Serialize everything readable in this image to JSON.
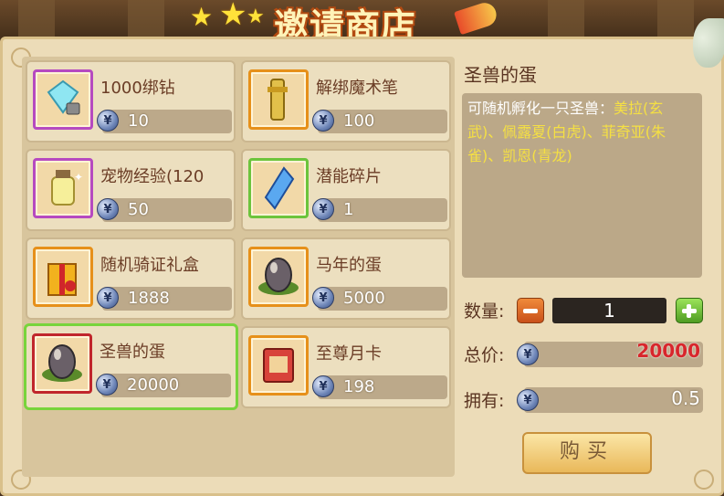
{
  "shop": {
    "title": "邀请商店"
  },
  "items": [
    {
      "name": "1000绑钻",
      "price": "10",
      "frame": "purple",
      "icon": "diamond-lock-icon"
    },
    {
      "name": "解绑魔术笔",
      "price": "100",
      "frame": "orange",
      "icon": "magic-pen-icon"
    },
    {
      "name": "宠物经验(120",
      "price": "50",
      "frame": "purple",
      "icon": "exp-bottle-icon"
    },
    {
      "name": "潜能碎片",
      "price": "1",
      "frame": "green",
      "icon": "blue-crystal-icon"
    },
    {
      "name": "随机骑证礼盒",
      "price": "1888",
      "frame": "orange",
      "icon": "gift-box-icon"
    },
    {
      "name": "马年的蛋",
      "price": "5000",
      "frame": "orange",
      "icon": "egg-icon"
    },
    {
      "name": "圣兽的蛋",
      "price": "20000",
      "frame": "red",
      "icon": "egg-icon",
      "selected": true
    },
    {
      "name": "至尊月卡",
      "price": "198",
      "frame": "orange",
      "icon": "month-card-icon"
    }
  ],
  "detail": {
    "title": "圣兽的蛋",
    "desc_prefix": "可随机孵化一只圣兽：",
    "desc_highlight": "美拉(玄武)、佩露夏(白虎)、菲奇亚(朱雀)、凯恩(青龙)",
    "qty_label": "数量:",
    "qty_value": "1",
    "total_label": "总价:",
    "total_value": "20000",
    "own_label": "拥有:",
    "own_value": "0.5",
    "buy_label": "购买"
  },
  "currency_symbol": "¥",
  "colors": {
    "selected_border": "#78d43c",
    "price_total": "#d8262c",
    "highlight": "#f5e043"
  }
}
